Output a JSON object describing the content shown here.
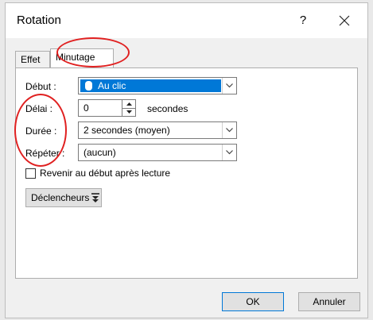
{
  "window": {
    "title": "Rotation",
    "help_label": "?"
  },
  "tabs": [
    {
      "label": "Effet"
    },
    {
      "label": "Minutage"
    }
  ],
  "form": {
    "debut_label": "Début :",
    "debut_value": "Au clic",
    "delai_label": "Délai :",
    "delai_value": "0",
    "delai_unit": "secondes",
    "duree_label": "Durée :",
    "duree_value": "2 secondes (moyen)",
    "repeter_label": "Répéter :",
    "repeter_value": "(aucun)",
    "rewind_label": "Revenir au début après lecture",
    "triggers_label": "Déclencheurs"
  },
  "footer": {
    "ok_label": "OK",
    "cancel_label": "Annuler"
  },
  "colors": {
    "annotation": "#e02020",
    "selection": "#0078d7"
  },
  "icons": [
    "close-icon",
    "mouse-icon",
    "chevron-down-icon",
    "spin-up-icon",
    "spin-down-icon",
    "triggers-icon"
  ]
}
